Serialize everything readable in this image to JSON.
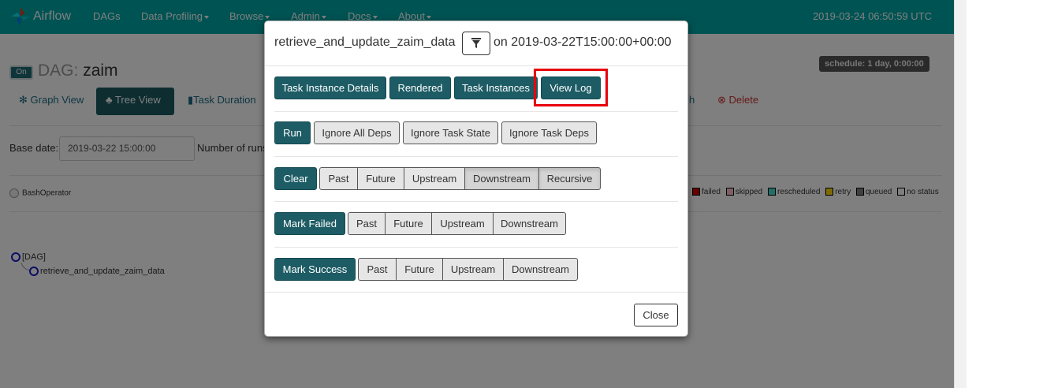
{
  "navbar": {
    "brand": "Airflow",
    "items": [
      {
        "label": "DAGs",
        "caret": false
      },
      {
        "label": "Data Profiling",
        "caret": true
      },
      {
        "label": "Browse",
        "caret": true
      },
      {
        "label": "Admin",
        "caret": true
      },
      {
        "label": "Docs",
        "caret": true
      },
      {
        "label": "About",
        "caret": true
      }
    ],
    "time": "2019-03-24 06:50:59 UTC"
  },
  "dag": {
    "toggle": "On",
    "label": "DAG:",
    "name": "zaim",
    "schedule": "schedule: 1 day, 0:00:00"
  },
  "tabs": {
    "graph": "Graph View",
    "tree": "Tree View",
    "duration": "Task Duration",
    "refresh_partial": "h",
    "delete": "Delete"
  },
  "controls": {
    "base_date_label": "Base date:",
    "base_date_value": "2019-03-22 15:00:00",
    "num_runs_label": "Number of runs"
  },
  "operator": "BashOperator",
  "legend": [
    {
      "label": "failed",
      "color": "#cc0000"
    },
    {
      "label": "skipped",
      "color": "#ffc0cb"
    },
    {
      "label": "rescheduled",
      "color": "#40e0d0"
    },
    {
      "label": "retry",
      "color": "#ffd700"
    },
    {
      "label": "queued",
      "color": "#808080"
    },
    {
      "label": "no status",
      "color": "#ffffff"
    }
  ],
  "tree": {
    "root": "[DAG]",
    "task": "retrieve_and_update_zaim_data"
  },
  "modal": {
    "task_id": "retrieve_and_update_zaim_data",
    "on_label": "on 2019-03-22T15:00:00+00:00",
    "row1": {
      "task_instance_details": "Task Instance Details",
      "rendered": "Rendered",
      "task_instances": "Task Instances",
      "view_log": "View Log"
    },
    "row2": {
      "run": "Run",
      "ignore_all_deps": "Ignore All Deps",
      "ignore_task_state": "Ignore Task State",
      "ignore_task_deps": "Ignore Task Deps"
    },
    "row3": {
      "clear": "Clear",
      "past": "Past",
      "future": "Future",
      "upstream": "Upstream",
      "downstream": "Downstream",
      "recursive": "Recursive"
    },
    "row4": {
      "mark_failed": "Mark Failed",
      "past": "Past",
      "future": "Future",
      "upstream": "Upstream",
      "downstream": "Downstream"
    },
    "row5": {
      "mark_success": "Mark Success",
      "past": "Past",
      "future": "Future",
      "upstream": "Upstream",
      "downstream": "Downstream"
    },
    "close": "Close"
  }
}
